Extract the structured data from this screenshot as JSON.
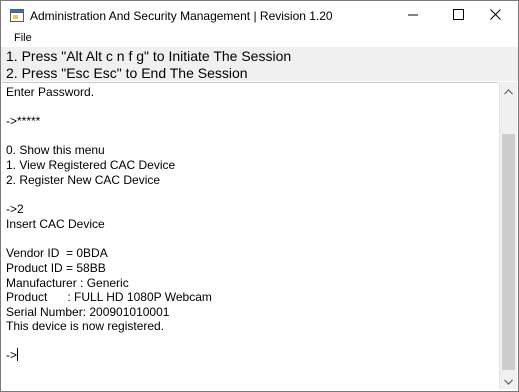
{
  "window": {
    "title": "Administration And Security Management  |  Revision 1.20",
    "icon": "app-window-icon",
    "controls": {
      "minimize_icon": "minimize-icon",
      "maximize_icon": "maximize-icon",
      "close_icon": "close-icon"
    }
  },
  "menu": {
    "file_label": "File"
  },
  "instructions": {
    "line1": "1. Press \"Alt Alt c n f g\" to Initiate The Session",
    "line2": "2. Press \"Esc Esc\" to End The Session"
  },
  "console": {
    "lines": [
      "Enter Password.",
      "",
      "->*****",
      "",
      "0. Show this menu",
      "1. View Registered CAC Device",
      "2. Register New CAC Device",
      "",
      "->2",
      "Insert CAC Device",
      "",
      "Vendor ID  = 0BDA",
      "Product ID = 58BB",
      "Manufacturer : Generic",
      "Product      : FULL HD 1080P Webcam",
      "Serial Number: 200901010001",
      "This device is now registered.",
      "",
      "->"
    ]
  },
  "colors": {
    "window_bg": "#ffffff",
    "instruction_bg": "#f0f0f0",
    "scrollbar_track": "#f0f0f0",
    "scrollbar_thumb": "#cdcdcd",
    "text": "#000000"
  }
}
